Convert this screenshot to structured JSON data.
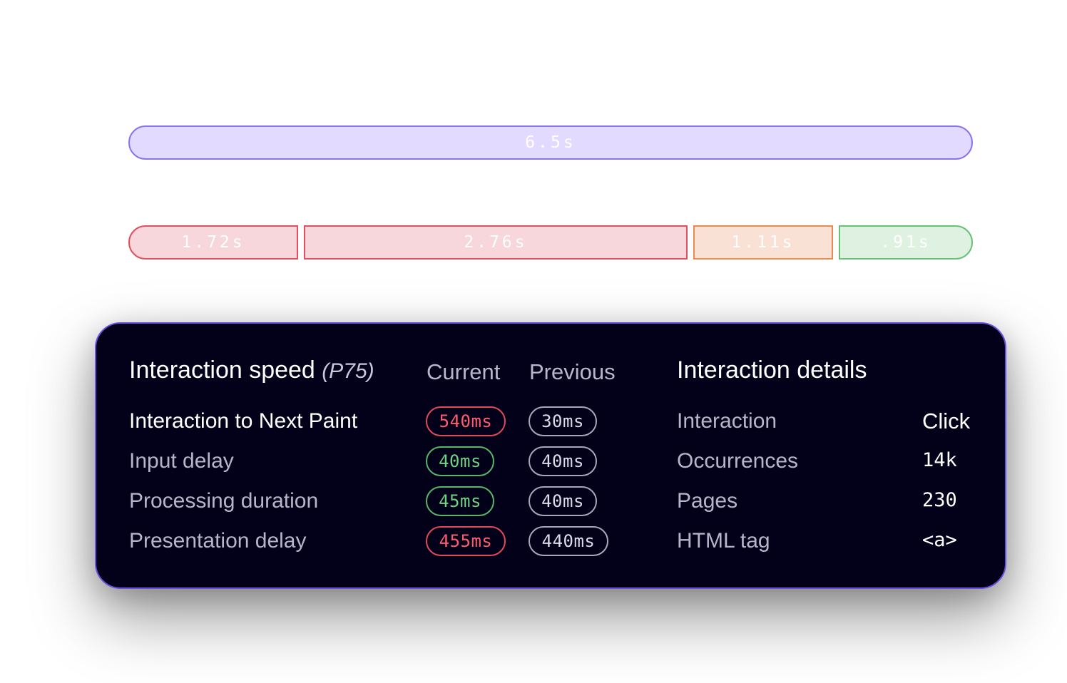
{
  "timeline": {
    "total": "6.5s",
    "segments": [
      "1.72s",
      "2.76s",
      "1.11s",
      ".91s"
    ]
  },
  "speed": {
    "title": "Interaction speed",
    "subtitle": "(P75)",
    "col_current": "Current",
    "col_previous": "Previous",
    "rows": [
      {
        "label": "Interaction to Next Paint",
        "current": "540ms",
        "previous": "30ms",
        "status": "poor"
      },
      {
        "label": "Input delay",
        "current": "40ms",
        "previous": "40ms",
        "status": "good"
      },
      {
        "label": "Processing duration",
        "current": "45ms",
        "previous": "40ms",
        "status": "good"
      },
      {
        "label": "Presentation delay",
        "current": "455ms",
        "previous": "440ms",
        "status": "poor"
      }
    ]
  },
  "details": {
    "title": "Interaction details",
    "rows": [
      {
        "label": "Interaction",
        "value": "Click"
      },
      {
        "label": "Occurrences",
        "value": "14k"
      },
      {
        "label": "Pages",
        "value": "230"
      },
      {
        "label": "HTML tag",
        "value": "<a>"
      }
    ]
  },
  "colors": {
    "card_bg": "#03001a",
    "card_border": "#6d4fe0",
    "poor": "#e2495a",
    "good": "#55b868",
    "warn": "#ea8a4d",
    "total": "#8c73f0"
  }
}
